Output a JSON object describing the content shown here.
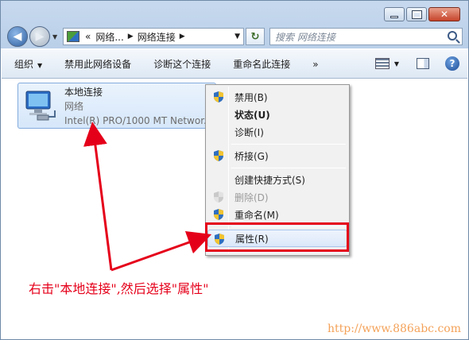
{
  "window": {
    "controls": {
      "minimize_icon": "minimize-icon",
      "maximize_icon": "maximize-icon",
      "close_glyph": "✕"
    }
  },
  "nav": {
    "back_glyph": "◀",
    "forward_glyph": "▶",
    "address": {
      "segments": [
        "«",
        "网络...",
        "▶",
        "网络连接",
        "▶"
      ],
      "dropdown": "▼"
    },
    "refresh_glyph": "↻",
    "search_placeholder": "搜索 网络连接"
  },
  "toolbar": {
    "organize": "组织",
    "organize_arrow": "▼",
    "disable": "禁用此网络设备",
    "diagnose": "诊断这个连接",
    "rename": "重命名此连接",
    "more": "»",
    "view_arrow": "▼",
    "help": "?"
  },
  "connection": {
    "name": "本地连接",
    "type": "网络",
    "adapter": "Intel(R) PRO/1000 MT Networ..."
  },
  "menu": {
    "items": [
      {
        "label": "禁用(B)",
        "shield": true
      },
      {
        "label": "状态(U)",
        "bold": true
      },
      {
        "label": "诊断(I)"
      },
      {
        "label": "桥接(G)",
        "shield": true
      },
      {
        "label": "创建快捷方式(S)"
      },
      {
        "label": "删除(D)",
        "shield": true,
        "disabled": true
      },
      {
        "label": "重命名(M)",
        "shield": true
      },
      {
        "label": "属性(R)",
        "shield": true,
        "highlighted": true
      }
    ]
  },
  "annotation": "右击\"本地连接\",然后选择\"属性\"",
  "watermark": "http://www.886abc.com",
  "colors": {
    "annotation": "#e5001a",
    "watermark": "#f4a259",
    "selection": "#d6e7fa"
  }
}
